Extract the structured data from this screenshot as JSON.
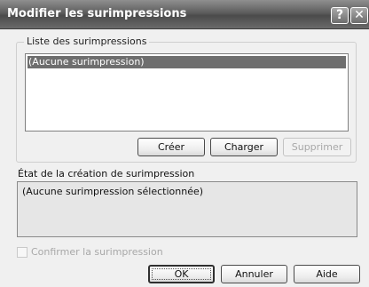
{
  "window": {
    "title": "Modifier les surimpressions",
    "help_glyph": "?",
    "close_glyph": "✕"
  },
  "list_group": {
    "legend": "Liste des surimpressions",
    "items": [
      {
        "label": "(Aucune surimpression)",
        "selected": true
      }
    ],
    "buttons": {
      "create": "Créer",
      "load": "Charger",
      "delete": "Supprimer"
    }
  },
  "status": {
    "label": "État de la création de surimpression",
    "text": "(Aucune surimpression sélectionnée)"
  },
  "confirm": {
    "label": "Confirmer la surimpression",
    "checked": false,
    "enabled": false
  },
  "footer": {
    "ok": "OK",
    "cancel": "Annuler",
    "help": "Aide"
  }
}
